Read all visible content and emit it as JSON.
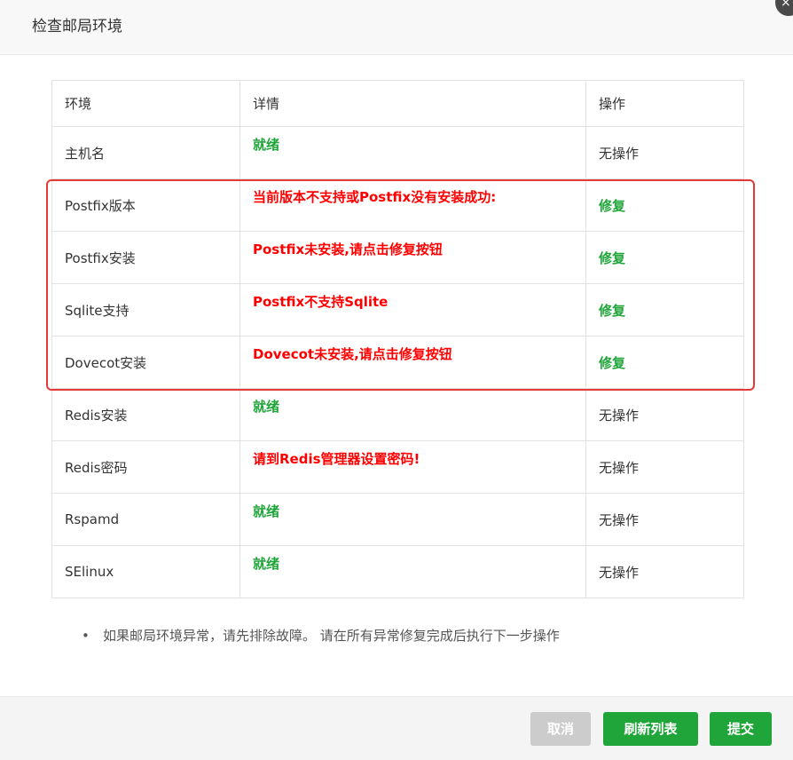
{
  "header": {
    "title": "检查邮局环境",
    "close_icon": "×"
  },
  "table": {
    "columns": [
      "环境",
      "详情",
      "操作"
    ],
    "rows": [
      {
        "env": "主机名",
        "detail": "就绪",
        "detail_status": "ok",
        "op": "无操作"
      },
      {
        "env": "Postfix版本",
        "detail": "当前版本不支持或Postfix没有安装成功:",
        "detail_status": "error",
        "op": "修复"
      },
      {
        "env": "Postfix安装",
        "detail": "Postfix未安装,请点击修复按钮",
        "detail_status": "error",
        "op": "修复"
      },
      {
        "env": "Sqlite支持",
        "detail": "Postfix不支持Sqlite",
        "detail_status": "error",
        "op": "修复"
      },
      {
        "env": "Dovecot安装",
        "detail": "Dovecot未安装,请点击修复按钮",
        "detail_status": "error",
        "op": "修复"
      },
      {
        "env": "Redis安装",
        "detail": "就绪",
        "detail_status": "ok",
        "op": "无操作"
      },
      {
        "env": "Redis密码",
        "detail": "请到Redis管理器设置密码!",
        "detail_status": "error",
        "op": "无操作"
      },
      {
        "env": "Rspamd",
        "detail": "就绪",
        "detail_status": "ok",
        "op": "无操作"
      },
      {
        "env": "SElinux",
        "detail": "就绪",
        "detail_status": "ok",
        "op": "无操作"
      }
    ]
  },
  "note": {
    "bullet": "•",
    "text": "如果邮局环境异常，请先排除故障。 请在所有异常修复完成后执行下一步操作"
  },
  "footer": {
    "cancel_label": "取消",
    "refresh_label": "刷新列表",
    "submit_label": "提交"
  },
  "colors": {
    "ok": "#20a53a",
    "error": "#ff0000",
    "highlight": "#e53935",
    "button_primary": "#20a53a",
    "button_disabled": "#cccccc"
  }
}
